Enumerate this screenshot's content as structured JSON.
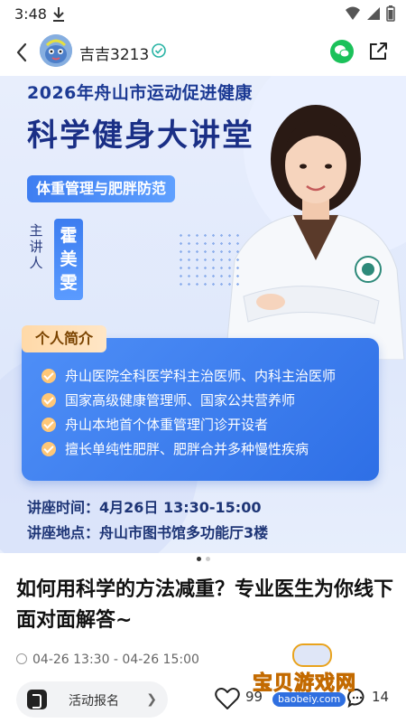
{
  "status_bar": {
    "time": "3:48",
    "icons": [
      "download-icon",
      "wifi-icon",
      "signal-icon",
      "battery-icon"
    ]
  },
  "header": {
    "username": "吉吉3213",
    "icons": [
      "back-icon",
      "verified-icon",
      "wechat-icon",
      "share-icon"
    ]
  },
  "poster": {
    "year_line": "2026年舟山市运动促进健康",
    "title": "科学健身大讲堂",
    "topic": "体重管理与肥胖防范",
    "speaker_label": "主讲人",
    "speaker_name": "霍美雯",
    "intro_tag": "个人简介",
    "intro_items": [
      "舟山医院全科医学科主治医师、内科主治医师",
      "国家高级健康管理师、国家公共营养师",
      "舟山本地首个体重管理门诊开设者",
      "擅长单纯性肥胖、肥胖合并多种慢性疾病"
    ],
    "time_line": "讲座时间：4月26日 13:30-15:00",
    "place_line": "讲座地点：舟山市图书馆多功能厅3楼",
    "colors": {
      "title": "#1a2f86",
      "accent": "#3e7ef1",
      "tag": "#ffd9a8"
    }
  },
  "pager": {
    "total": 2,
    "active": 0
  },
  "post": {
    "title": "如何用科学的方法减重？专业医生为你线下面对面解答~",
    "date": "04-26 13:30 - 04-26 15:00"
  },
  "bottom_bar": {
    "signup_label": "活动报名",
    "like_count": "99",
    "comment_count": "14"
  },
  "watermark": {
    "text": "宝贝游戏网",
    "url": "baobeiy.com"
  }
}
